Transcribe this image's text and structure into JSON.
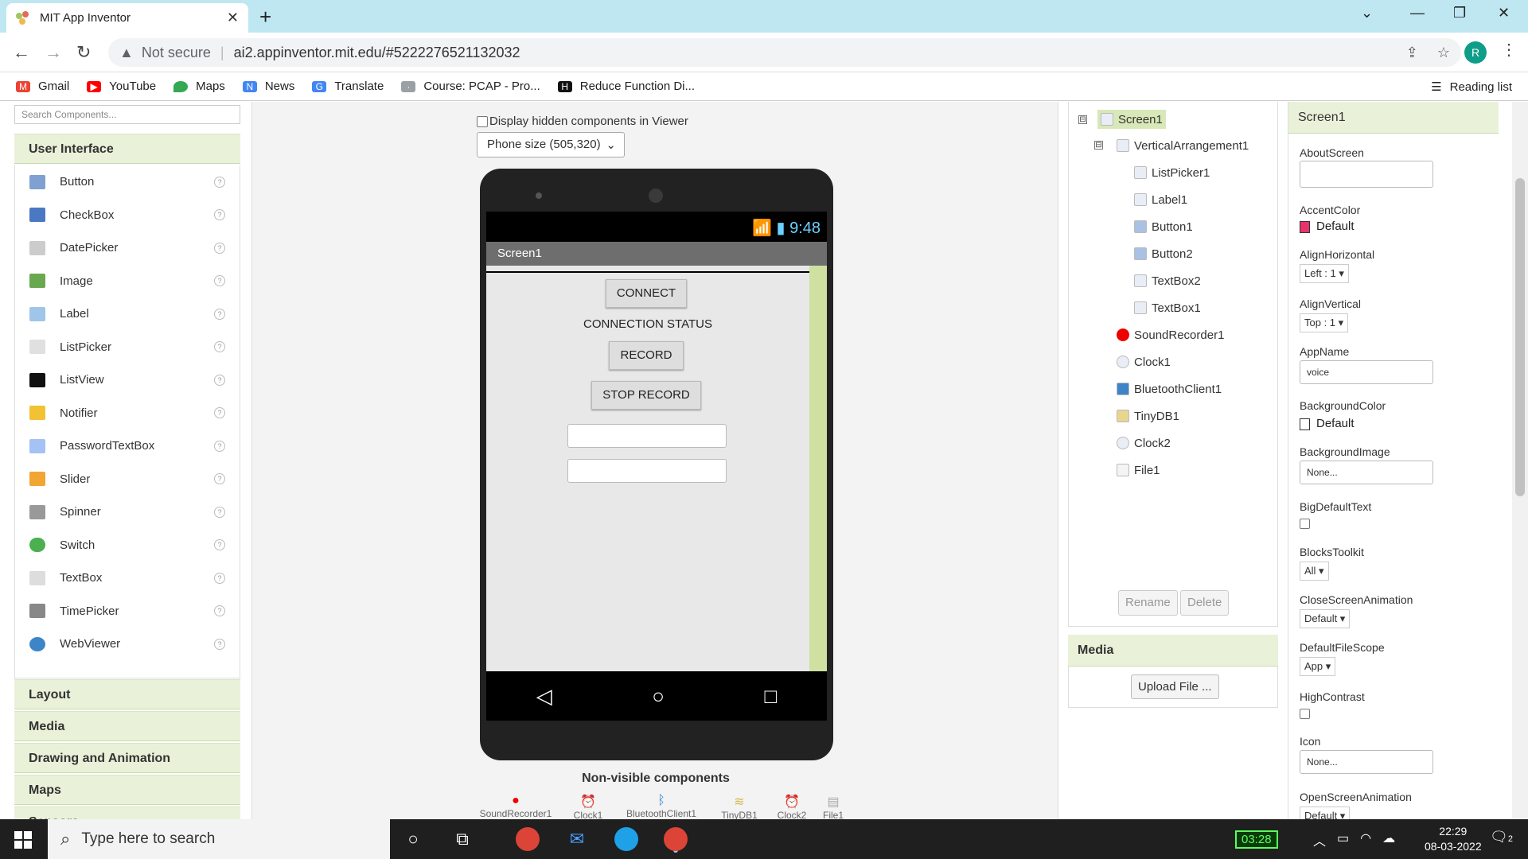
{
  "browser": {
    "tab_title": "MIT App Inventor",
    "not_secure": "Not secure",
    "url": "ai2.appinventor.mit.edu/#5222276521132032",
    "avatar_letter": "R",
    "bookmarks": [
      {
        "label": "Gmail",
        "color": "#ea4335"
      },
      {
        "label": "YouTube",
        "color": "#ff0000"
      },
      {
        "label": "Maps",
        "color": "#34a853"
      },
      {
        "label": "News",
        "color": "#4285f4"
      },
      {
        "label": "Translate",
        "color": "#4285f4"
      },
      {
        "label": "Course: PCAP - Pro...",
        "color": "#9aa0a6"
      },
      {
        "label": "Reduce Function Di...",
        "color": "#111111"
      }
    ],
    "reading_list": "Reading list"
  },
  "palette": {
    "search_placeholder": "Search Components...",
    "user_interface": "User Interface",
    "items": [
      {
        "label": "Button",
        "color": "#7fa0d0"
      },
      {
        "label": "CheckBox",
        "color": "#4a78c2"
      },
      {
        "label": "DatePicker",
        "color": "#cccccc"
      },
      {
        "label": "Image",
        "color": "#6aa84f"
      },
      {
        "label": "Label",
        "color": "#9fc5e8"
      },
      {
        "label": "ListPicker",
        "color": "#e0e0e0"
      },
      {
        "label": "ListView",
        "color": "#111111"
      },
      {
        "label": "Notifier",
        "color": "#f1c232"
      },
      {
        "label": "PasswordTextBox",
        "color": "#a4c2f4"
      },
      {
        "label": "Slider",
        "color": "#f1a532"
      },
      {
        "label": "Spinner",
        "color": "#999999"
      },
      {
        "label": "Switch",
        "color": "#4caf50"
      },
      {
        "label": "TextBox",
        "color": "#dddddd"
      },
      {
        "label": "TimePicker",
        "color": "#888888"
      },
      {
        "label": "WebViewer",
        "color": "#3d85c6"
      }
    ],
    "help_glyph": "?",
    "sections": [
      "Layout",
      "Media",
      "Drawing and Animation",
      "Maps",
      "Sensors"
    ]
  },
  "viewer": {
    "hidden_checkbox_label": "Display hidden components in Viewer",
    "phone_size": "Phone size (505,320)",
    "status_time": "9:48",
    "screen_title": "Screen1",
    "connect_label": "CONNECT",
    "status_label": "CONNECTION STATUS",
    "record_label": "RECORD",
    "stop_record_label": "STOP RECORD",
    "nonvisible_title": "Non-visible components",
    "nonvisible": [
      "SoundRecorder1",
      "Clock1",
      "BluetoothClient1",
      "TinyDB1",
      "Clock2",
      "File1"
    ]
  },
  "tree": {
    "screen": "Screen1",
    "arrangement": "VerticalArrangement1",
    "children": [
      "ListPicker1",
      "Label1",
      "Button1",
      "Button2",
      "TextBox2",
      "TextBox1"
    ],
    "nonvisible": [
      "SoundRecorder1",
      "Clock1",
      "BluetoothClient1",
      "TinyDB1",
      "Clock2",
      "File1"
    ],
    "rename_label": "Rename",
    "delete_label": "Delete",
    "collapse_glyph": "⊟"
  },
  "media": {
    "title": "Media",
    "upload_label": "Upload File ..."
  },
  "properties": {
    "header": "Screen1",
    "about_screen": "AboutScreen",
    "accent_color": "AccentColor",
    "accent_value": "Default",
    "accent_hex": "#e8336b",
    "align_h": "AlignHorizontal",
    "align_h_value": "Left : 1 ▾",
    "align_v": "AlignVertical",
    "align_v_value": "Top : 1 ▾",
    "app_name": "AppName",
    "app_name_value": "voice",
    "bg_color": "BackgroundColor",
    "bg_color_value": "Default",
    "bg_image": "BackgroundImage",
    "bg_image_value": "None...",
    "big_text": "BigDefaultText",
    "blocks_toolkit": "BlocksToolkit",
    "blocks_toolkit_value": "All ▾",
    "close_anim": "CloseScreenAnimation",
    "close_anim_value": "Default ▾",
    "file_scope": "DefaultFileScope",
    "file_scope_value": "App ▾",
    "high_contrast": "HighContrast",
    "icon": "Icon",
    "icon_value": "None...",
    "open_anim": "OpenScreenAnimation",
    "open_anim_value": "Default ▾"
  },
  "taskbar": {
    "search_placeholder": "Type here to search",
    "timer": "03:28",
    "time": "22:29",
    "date": "08-03-2022",
    "notif_count": "2"
  }
}
